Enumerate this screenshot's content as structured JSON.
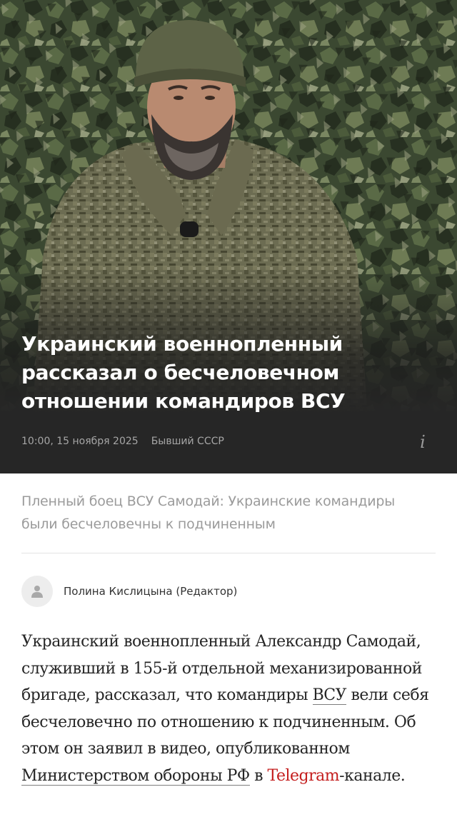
{
  "article": {
    "title": "Украинский военнопленный рассказал о бесчеловечном отношении командиров ВСУ",
    "date": "10:00, 15 ноября 2025",
    "source": "Бывший СССР",
    "info_icon": "i",
    "lead": "Пленный боец ВСУ Самодай: Украинские командиры были бесчеловечны к подчиненным",
    "author": "Полина Кислицына (Редактор)",
    "body": {
      "part1": "Украинский военнопленный Александр Самодай, служивший в 155-й отдельной механизированной бригаде, рассказал, что командиры ",
      "link_vsu": "ВСУ",
      "part2": " вели себя бесчеловечно по отношению к подчиненным. Об этом он заявил в видео, опубликованном ",
      "link_mod": "Министерством обороны РФ",
      "part3": " в ",
      "link_telegram": "Telegram",
      "part4": "-каналe."
    }
  },
  "colors": {
    "title_text": "#ffffff",
    "hero_footer_bg": "#262626",
    "meta_text": "#a6a6a6",
    "lead_text": "#9b9b9b",
    "body_text": "#262626",
    "telegram_link": "#c41e1e"
  },
  "icons": {
    "info": "info-icon",
    "avatar": "user-avatar-icon"
  }
}
